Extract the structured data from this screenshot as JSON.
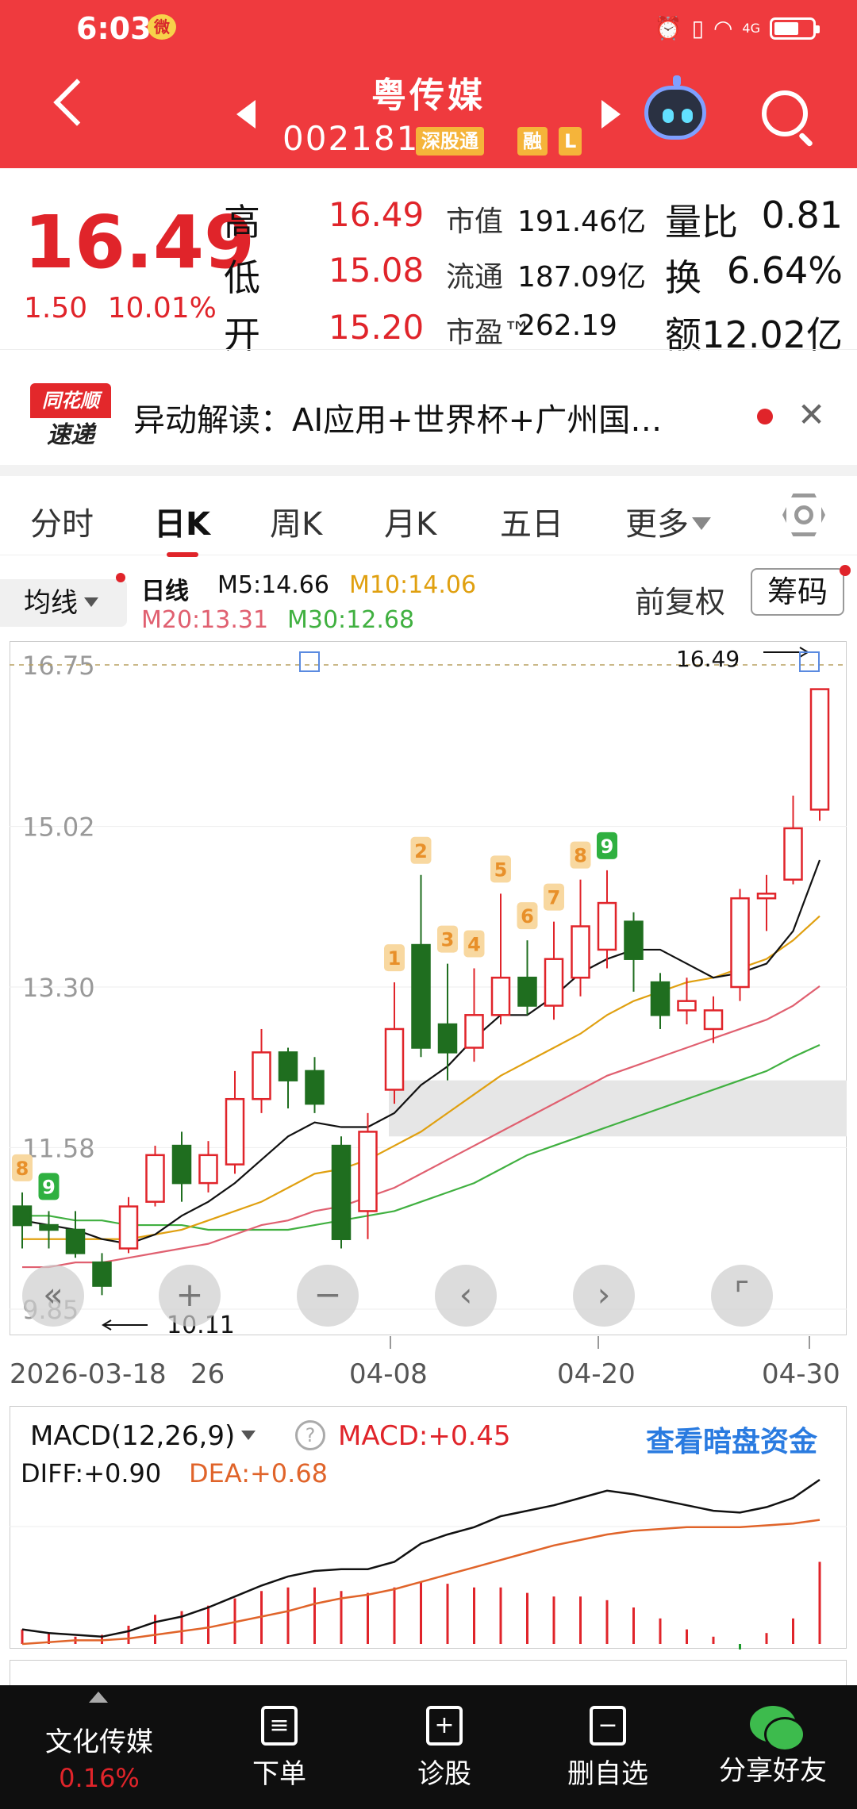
{
  "status": {
    "time": "6:03",
    "network": "4G"
  },
  "header": {
    "name": "粤传媒",
    "code": "002181",
    "tag1": "深股通",
    "tag2": "融",
    "tag3": "L"
  },
  "quote": {
    "price": "16.49",
    "change": "1.50",
    "change_pct": "10.01%",
    "high_label": "高",
    "high": "16.49",
    "low_label": "低",
    "low": "15.08",
    "open_label": "开",
    "open": "15.20",
    "mktcap_label": "市值",
    "mktcap": "191.46亿",
    "float_label": "流通",
    "float": "187.09亿",
    "pe_label": "市盈™",
    "pe": "262.19",
    "vr_label": "量比",
    "vr": "0.81",
    "turnover_label": "换",
    "turnover": "6.64%",
    "amount_label": "额",
    "amount": "12.02亿"
  },
  "news": {
    "logo_top": "同花顺",
    "logo_bottom": "速递",
    "text": "异动解读：AI应用+世界杯+广州国…"
  },
  "tabs": {
    "t1": "分时",
    "t2": "日K",
    "t3": "周K",
    "t4": "月K",
    "t5": "五日",
    "t6": "更多"
  },
  "ma": {
    "selector": "均线",
    "period": "日线",
    "m5": "M5:14.66",
    "m10": "M10:14.06",
    "m20": "M20:13.31",
    "m30": "M30:12.68",
    "fq": "前复权",
    "chip": "筹码"
  },
  "colors": {
    "up": "#e0242a",
    "down": "#1f6e1f",
    "m5": "#111111",
    "m10": "#e0a010",
    "m20": "#e06070",
    "m30": "#40b040",
    "header": "#ef3a3e"
  },
  "chart_data": [
    {
      "type": "candlestick",
      "title": "日线",
      "y_ticks": [
        "16.75",
        "15.02",
        "13.30",
        "11.58",
        "9.85"
      ],
      "ylim": [
        9.85,
        16.75
      ],
      "x_ticks": [
        "2026-03-18",
        "26",
        "04-08",
        "04-20",
        "04-30"
      ],
      "annotations": {
        "high_label": "16.49",
        "low_label": "10.11"
      },
      "td_counts": [
        {
          "label": "8",
          "color": "orange"
        },
        {
          "label": "9",
          "color": "green"
        },
        {
          "label": "1"
        },
        {
          "label": "2"
        },
        {
          "label": "3"
        },
        {
          "label": "4"
        },
        {
          "label": "5"
        },
        {
          "label": "6"
        },
        {
          "label": "7"
        },
        {
          "label": "8"
        },
        {
          "label": "9",
          "color": "green"
        }
      ],
      "candles": [
        [
          10.95,
          10.75,
          11.1,
          10.5
        ],
        [
          10.75,
          10.7,
          10.9,
          10.5
        ],
        [
          10.7,
          10.45,
          10.9,
          10.4
        ],
        [
          10.35,
          10.1,
          10.45,
          10.0
        ],
        [
          10.5,
          10.95,
          11.05,
          10.45
        ],
        [
          11.0,
          11.5,
          11.6,
          10.95
        ],
        [
          11.6,
          11.2,
          11.75,
          11.0
        ],
        [
          11.2,
          11.5,
          11.65,
          11.1
        ],
        [
          11.4,
          12.1,
          12.4,
          11.3
        ],
        [
          12.1,
          12.6,
          12.85,
          11.95
        ],
        [
          12.6,
          12.3,
          12.65,
          12.0
        ],
        [
          12.4,
          12.05,
          12.55,
          11.95
        ],
        [
          11.6,
          10.6,
          11.7,
          10.5
        ],
        [
          10.9,
          11.75,
          11.95,
          10.6
        ],
        [
          12.2,
          12.85,
          13.35,
          12.05
        ],
        [
          13.75,
          12.65,
          14.5,
          12.55
        ],
        [
          12.9,
          12.6,
          13.55,
          12.3
        ],
        [
          12.65,
          13.0,
          13.5,
          12.5
        ],
        [
          13.0,
          13.4,
          14.3,
          12.9
        ],
        [
          13.4,
          13.1,
          13.8,
          13.0
        ],
        [
          13.1,
          13.6,
          14.0,
          12.95
        ],
        [
          13.4,
          13.95,
          14.45,
          13.2
        ],
        [
          13.7,
          14.2,
          14.55,
          13.5
        ],
        [
          14.0,
          13.6,
          14.1,
          13.25
        ],
        [
          13.35,
          13.0,
          13.45,
          12.85
        ],
        [
          13.05,
          13.15,
          13.4,
          12.9
        ],
        [
          12.85,
          13.05,
          13.2,
          12.7
        ],
        [
          13.3,
          14.25,
          14.35,
          13.15
        ],
        [
          14.25,
          14.3,
          14.5,
          13.9
        ],
        [
          14.45,
          15.0,
          15.35,
          14.4
        ],
        [
          15.2,
          16.49,
          16.49,
          15.08
        ]
      ],
      "ma5": [
        10.8,
        10.75,
        10.7,
        10.6,
        10.55,
        10.65,
        10.85,
        11.0,
        11.2,
        11.45,
        11.7,
        11.85,
        11.8,
        11.8,
        11.95,
        12.25,
        12.45,
        12.75,
        13.0,
        13.0,
        13.2,
        13.45,
        13.6,
        13.7,
        13.7,
        13.55,
        13.4,
        13.45,
        13.55,
        13.9,
        14.66
      ],
      "ma10": [
        10.6,
        10.6,
        10.6,
        10.6,
        10.6,
        10.65,
        10.7,
        10.8,
        10.9,
        11.0,
        11.15,
        11.3,
        11.35,
        11.45,
        11.6,
        11.75,
        11.95,
        12.15,
        12.35,
        12.5,
        12.65,
        12.8,
        13.0,
        13.15,
        13.25,
        13.35,
        13.4,
        13.5,
        13.6,
        13.8,
        14.06
      ],
      "ma20": [
        10.3,
        10.3,
        10.35,
        10.35,
        10.4,
        10.45,
        10.5,
        10.55,
        10.65,
        10.75,
        10.8,
        10.9,
        10.95,
        11.05,
        11.15,
        11.3,
        11.45,
        11.6,
        11.75,
        11.9,
        12.05,
        12.2,
        12.35,
        12.45,
        12.55,
        12.65,
        12.75,
        12.85,
        12.95,
        13.1,
        13.31
      ],
      "ma30": [
        10.85,
        10.85,
        10.8,
        10.8,
        10.75,
        10.75,
        10.75,
        10.7,
        10.7,
        10.7,
        10.7,
        10.75,
        10.8,
        10.85,
        10.9,
        11.0,
        11.1,
        11.2,
        11.35,
        11.5,
        11.6,
        11.7,
        11.8,
        11.9,
        12.0,
        12.1,
        12.2,
        12.3,
        12.4,
        12.55,
        12.68
      ]
    },
    {
      "type": "bar",
      "title": "MACD(12,26,9)",
      "series": [
        {
          "name": "MACD",
          "values": [
            0.08,
            0.06,
            0.04,
            0.05,
            0.1,
            0.16,
            0.18,
            0.21,
            0.25,
            0.29,
            0.31,
            0.31,
            0.29,
            0.28,
            0.31,
            0.34,
            0.33,
            0.31,
            0.31,
            0.28,
            0.26,
            0.26,
            0.24,
            0.2,
            0.14,
            0.08,
            0.04,
            -0.03,
            0.06,
            0.14,
            0.45
          ]
        },
        {
          "name": "DIFF",
          "values": [
            0.08,
            0.06,
            0.05,
            0.04,
            0.07,
            0.12,
            0.15,
            0.2,
            0.26,
            0.32,
            0.37,
            0.4,
            0.41,
            0.41,
            0.45,
            0.55,
            0.6,
            0.64,
            0.7,
            0.73,
            0.76,
            0.8,
            0.84,
            0.82,
            0.79,
            0.76,
            0.73,
            0.72,
            0.75,
            0.8,
            0.9
          ]
        },
        {
          "name": "DEA",
          "values": [
            0.0,
            0.01,
            0.02,
            0.02,
            0.03,
            0.05,
            0.07,
            0.09,
            0.12,
            0.15,
            0.18,
            0.22,
            0.25,
            0.27,
            0.3,
            0.34,
            0.38,
            0.42,
            0.46,
            0.5,
            0.54,
            0.57,
            0.6,
            0.62,
            0.63,
            0.64,
            0.64,
            0.64,
            0.65,
            0.66,
            0.68
          ]
        }
      ],
      "labels": {
        "diff": "DIFF:+0.90",
        "dea": "DEA:+0.68",
        "macd": "MACD:+0.45",
        "link": "查看暗盘资金"
      }
    }
  ],
  "bottom_nav": {
    "sector": "文化传媒",
    "sector_pct": "0.16%",
    "order": "下单",
    "diagnose": "诊股",
    "remove": "删自选",
    "share": "分享好友"
  }
}
